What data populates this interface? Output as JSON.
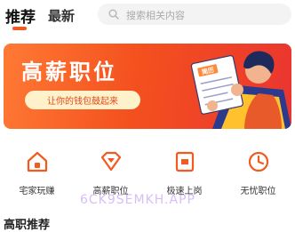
{
  "header": {
    "tabs": [
      {
        "label": "推荐",
        "active": true
      },
      {
        "label": "最新",
        "active": false
      }
    ],
    "search": {
      "placeholder": "搜索相关内容",
      "icon": "search-icon"
    }
  },
  "banner": {
    "title": "高薪职位",
    "subtitle": "让你的钱包鼓起来",
    "badge": "简历",
    "colors": {
      "start": "#ff7a35",
      "end": "#ea3530",
      "pill": "#fff1c9"
    }
  },
  "quick_actions": [
    {
      "label": "宅家玩赚",
      "icon": "home-icon"
    },
    {
      "label": "高薪职位",
      "icon": "diamond-icon"
    },
    {
      "label": "极速上岗",
      "icon": "doc-icon"
    },
    {
      "label": "无忧职位",
      "icon": "clock-icon"
    }
  ],
  "watermark": "6CK9SEMKH.APP",
  "section_title": "高职推荐",
  "accent_color": "#f25a1f"
}
